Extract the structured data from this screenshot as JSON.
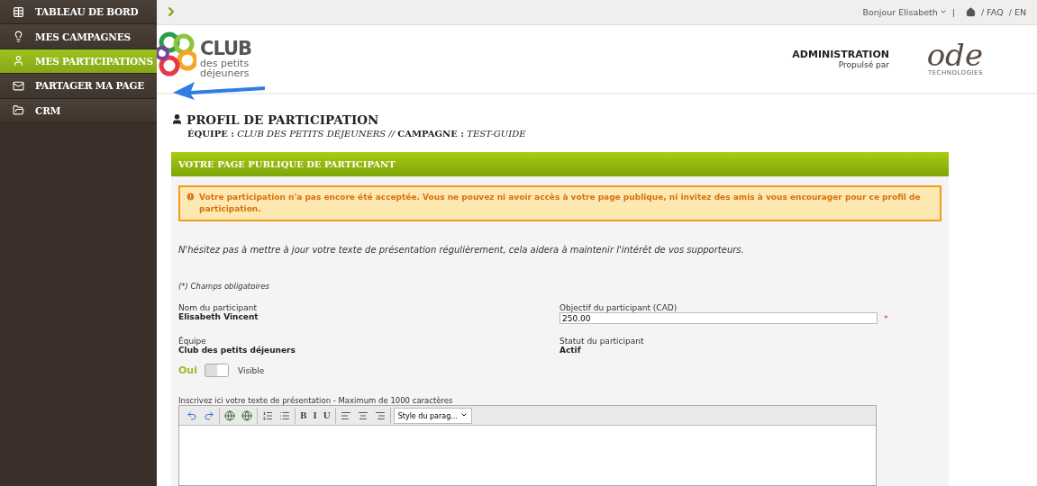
{
  "sidebar": {
    "items": [
      {
        "label": "TABLEAU DE BORD",
        "selected": false
      },
      {
        "label": "MES CAMPAGNES",
        "selected": false
      },
      {
        "label": "MES PARTICIPATIONS",
        "selected": true
      },
      {
        "label": "PARTAGER MA PAGE",
        "selected": false
      },
      {
        "label": "CRM",
        "selected": false
      }
    ]
  },
  "top_bar": {
    "greeting": "Bonjour Elisabeth",
    "separator": "|",
    "links": [
      "/ FAQ",
      "/ EN"
    ]
  },
  "header": {
    "logo": {
      "line_1": "CLUB",
      "line_2": "des petits",
      "line_3": "déjeuners"
    },
    "admin_title": "ADMINISTRATION",
    "powered_by": "Propulsé par",
    "brand": {
      "name": "ode",
      "tagline": "TECHNOLOGIES"
    }
  },
  "page": {
    "title": "PROFIL DE PARTICIPATION",
    "subtitle": "**ÉQUIPE :** *CLUB DES PETITS DÉJEUNERS //* **CAMPAGNE :** *TEST-GUIDE*"
  },
  "panel": {
    "title": "VOTRE PAGE PUBLIQUE DE PARTICIPANT",
    "warning": "Votre participation n'a pas encore été acceptée. Vous ne pouvez ni avoir accès à votre page publique, ni invitez des amis à vous encourager pour ce profil de participation.",
    "intro": "N'hésitez pas à mettre à jour votre texte de présentation régulièrement, cela aidera à maintenir l'intérêt de vos supporteurs.",
    "required_note": "(*) Champs obligatoires",
    "fields": [
      {
        "kind": "text",
        "label": "Nom du participant",
        "value": "Elisabeth Vincent"
      },
      {
        "kind": "input",
        "label": "Objectif du participant (CAD)",
        "value": "250.00",
        "required_mark": "*"
      },
      {
        "kind": "text",
        "label": "Équipe",
        "value": "Club des petits déjeuners"
      },
      {
        "kind": "text",
        "label": "Statut du participant",
        "value": "Actif"
      }
    ],
    "visibility": {
      "state_label": "Oui",
      "on": true,
      "caption": "Visible"
    },
    "editor": {
      "label": "Inscrivez ici votre texte de présentation - Maximum de 1000 caractères",
      "tools": [
        {
          "kind": "undo"
        },
        {
          "kind": "redo"
        },
        {
          "kind": "sep"
        },
        {
          "kind": "link"
        },
        {
          "kind": "unlink"
        },
        {
          "kind": "sep"
        },
        {
          "kind": "ol"
        },
        {
          "kind": "ul"
        },
        {
          "kind": "sep"
        },
        {
          "kind": "char",
          "text": "B"
        },
        {
          "kind": "char",
          "text": "I"
        },
        {
          "kind": "char",
          "text": "U"
        },
        {
          "kind": "sep"
        },
        {
          "kind": "left"
        },
        {
          "kind": "center"
        },
        {
          "kind": "right"
        },
        {
          "kind": "sep"
        },
        {
          "kind": "select",
          "text": "Style du parag..."
        }
      ]
    }
  }
}
